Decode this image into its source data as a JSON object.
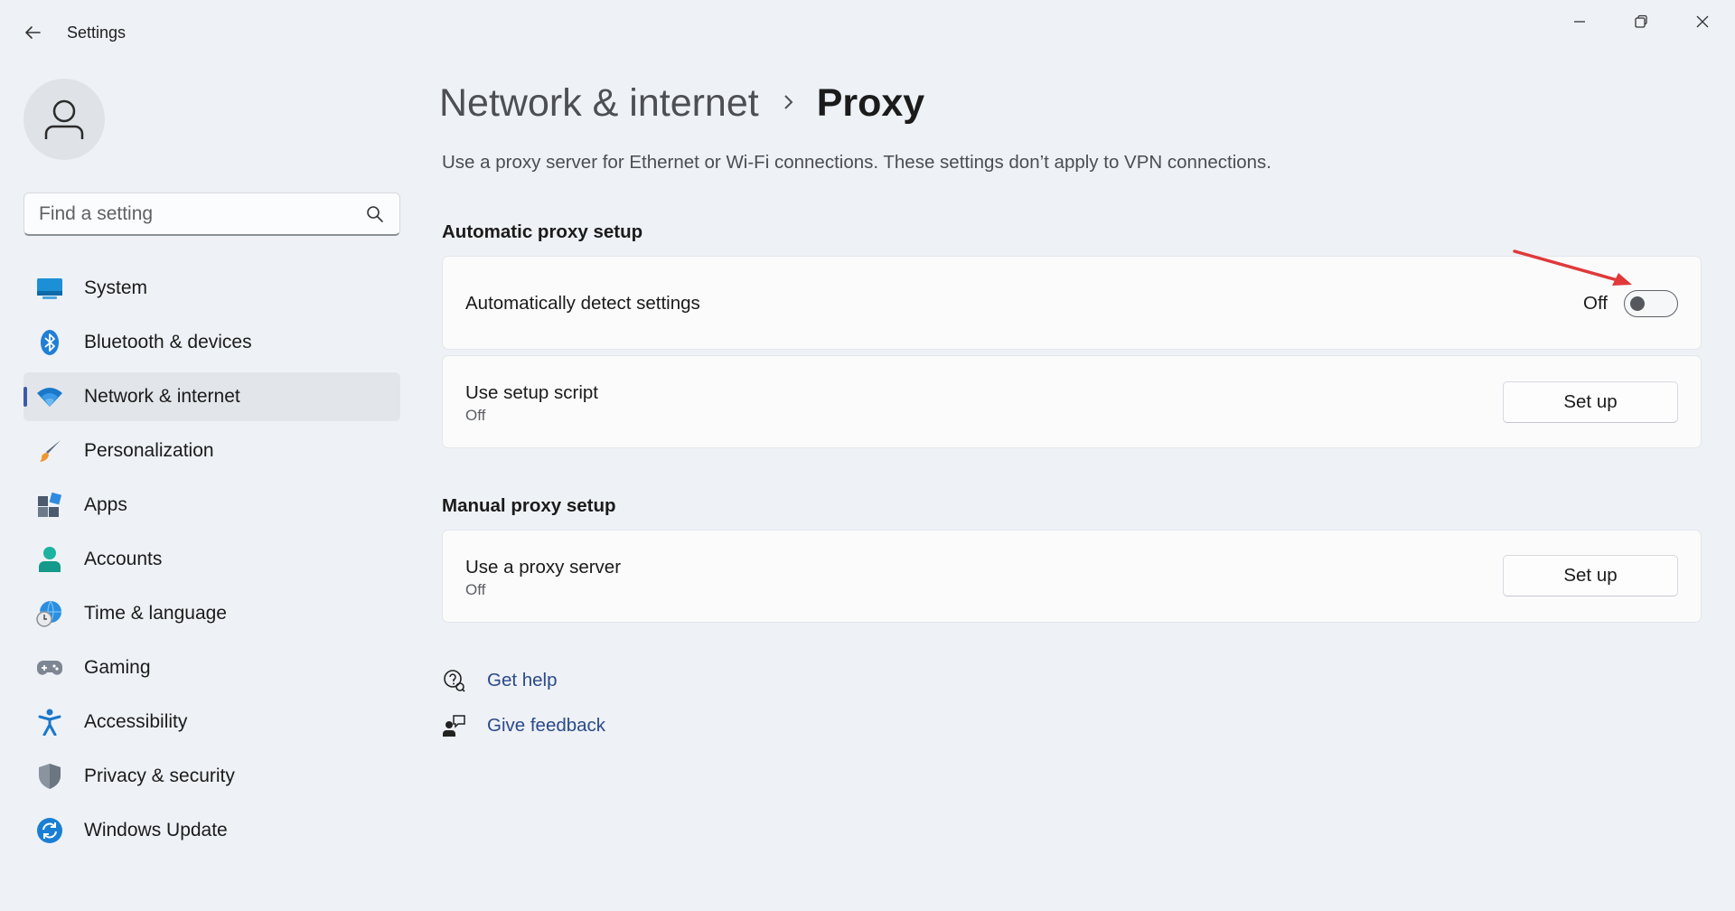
{
  "window": {
    "title": "Settings"
  },
  "search": {
    "placeholder": "Find a setting"
  },
  "sidebar": {
    "items": [
      {
        "label": "System",
        "icon": "system-icon"
      },
      {
        "label": "Bluetooth & devices",
        "icon": "bluetooth-icon"
      },
      {
        "label": "Network & internet",
        "icon": "wifi-icon",
        "selected": true
      },
      {
        "label": "Personalization",
        "icon": "brush-icon"
      },
      {
        "label": "Apps",
        "icon": "apps-icon"
      },
      {
        "label": "Accounts",
        "icon": "accounts-icon"
      },
      {
        "label": "Time & language",
        "icon": "globe-clock-icon"
      },
      {
        "label": "Gaming",
        "icon": "gamepad-icon"
      },
      {
        "label": "Accessibility",
        "icon": "accessibility-icon"
      },
      {
        "label": "Privacy & security",
        "icon": "shield-icon"
      },
      {
        "label": "Windows Update",
        "icon": "update-icon"
      }
    ]
  },
  "breadcrumb": {
    "parent": "Network & internet",
    "separator": ">",
    "current": "Proxy"
  },
  "description": "Use a proxy server for Ethernet or Wi-Fi connections. These settings don’t apply to VPN connections.",
  "automatic": {
    "section_title": "Automatic proxy setup",
    "detect": {
      "label": "Automatically detect settings",
      "state_text": "Off",
      "on": false
    },
    "script": {
      "label": "Use setup script",
      "status": "Off",
      "button": "Set up"
    }
  },
  "manual": {
    "section_title": "Manual proxy setup",
    "proxy": {
      "label": "Use a proxy server",
      "status": "Off",
      "button": "Set up"
    }
  },
  "links": {
    "help": "Get help",
    "feedback": "Give feedback"
  },
  "colors": {
    "accent": "#3c5aa8",
    "annotation_arrow": "#e0393a",
    "link": "#2a4a8a"
  }
}
